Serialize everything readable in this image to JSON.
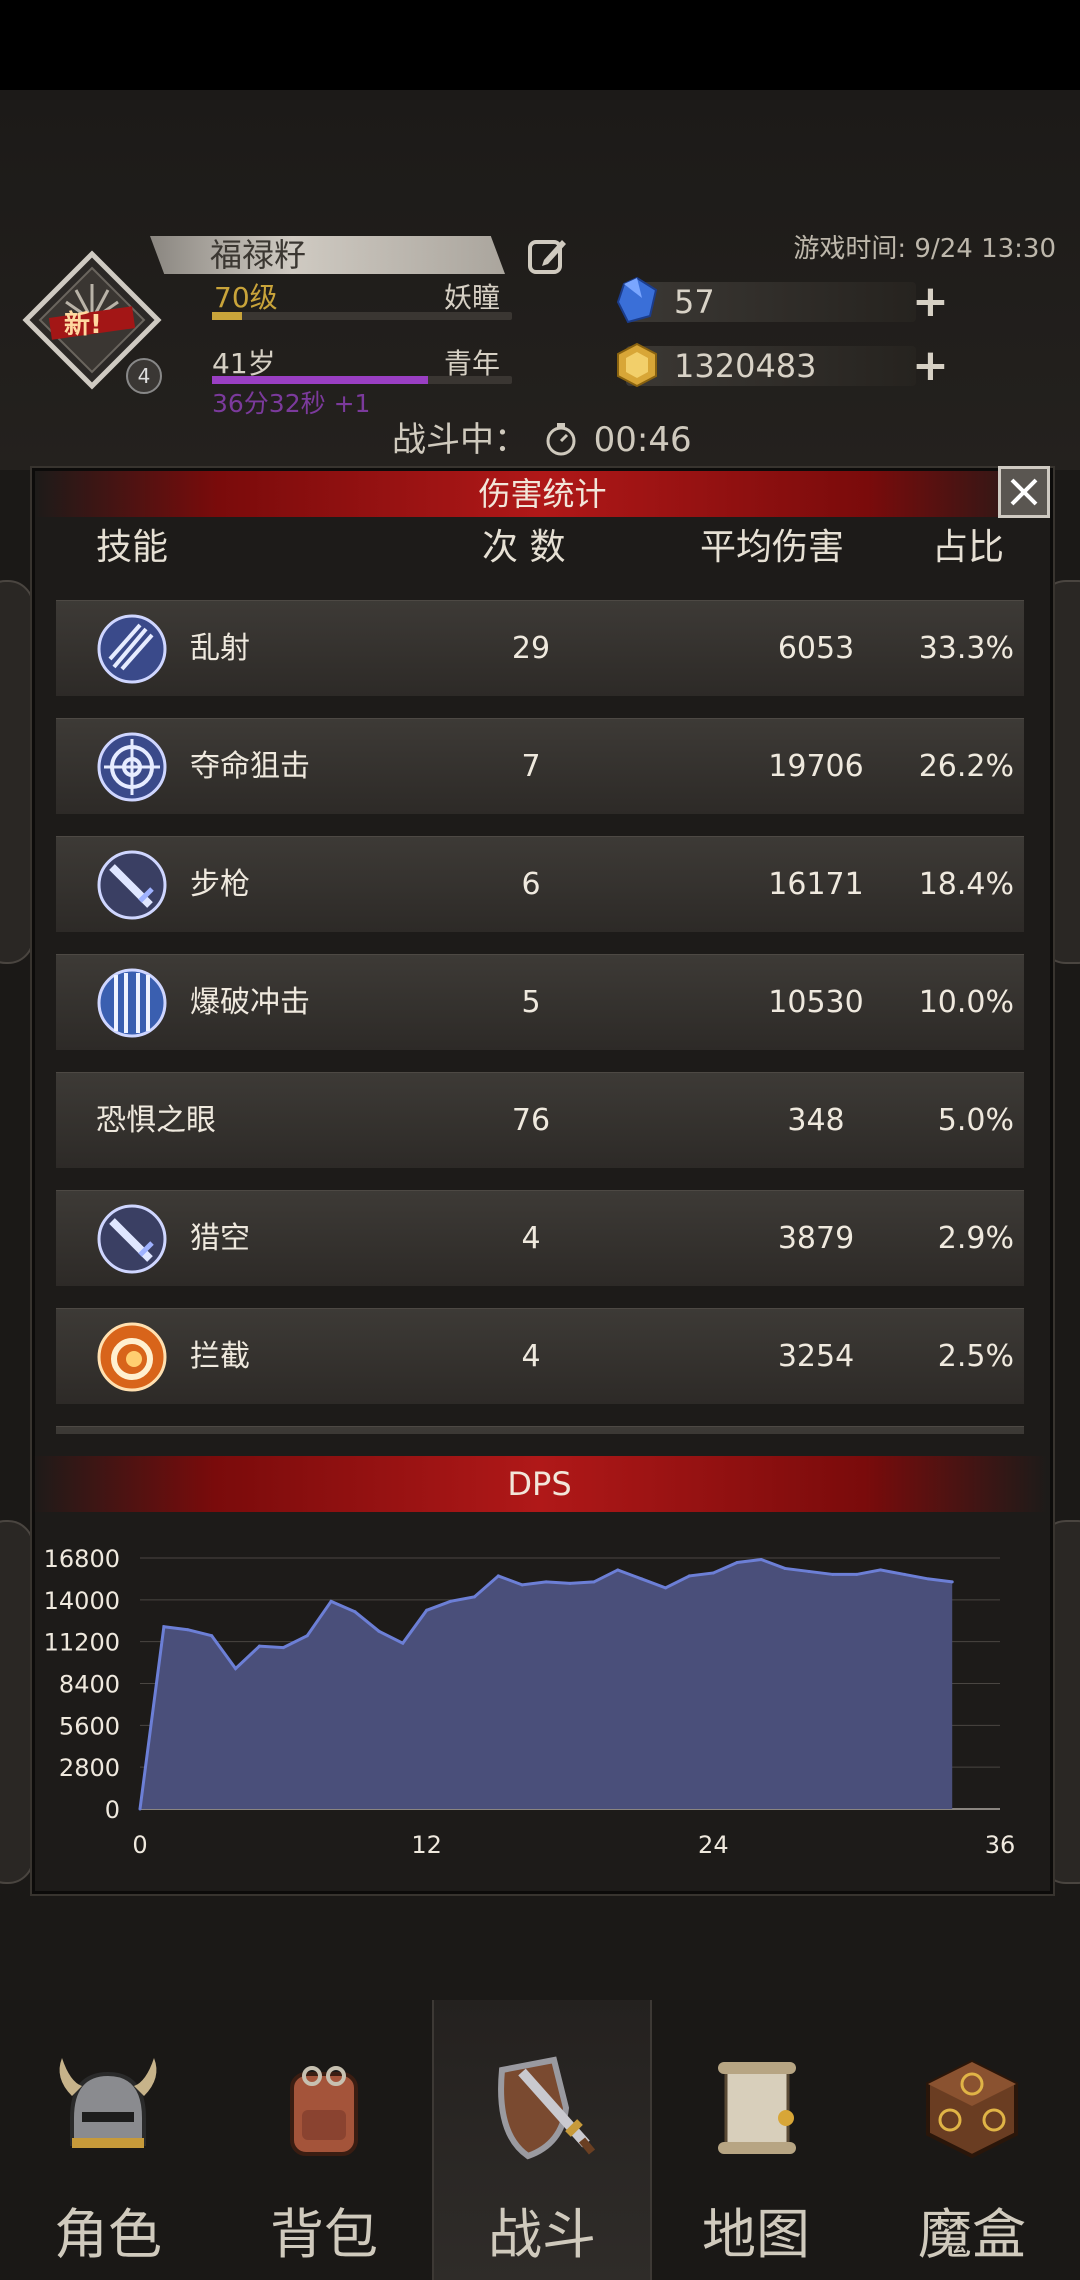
{
  "header": {
    "character_name": "福禄籽",
    "new_badge": "新!",
    "avatar_level": "4",
    "level_text": "70级",
    "race": "妖瞳",
    "age": "41岁",
    "age_stage": "青年",
    "timer_text": "36分32秒 +1",
    "game_time": "游戏时间: 9/24 13:30",
    "gems": "57",
    "gold": "1320483",
    "battle_label": "战斗中：",
    "battle_time": "00:46",
    "colors": {
      "level": "#c9a43a",
      "timer": "#9a3fc3",
      "gem": "#3a6fd8",
      "gold": "#d8a637"
    }
  },
  "panel": {
    "title": "伤害统计",
    "close_icon": "close-icon",
    "columns": {
      "skill": "技能",
      "count": "次 数",
      "avg": "平均伤害",
      "share": "占比"
    },
    "rows": [
      {
        "name": "乱射",
        "count": "29",
        "avg": "6053",
        "share": "33.3%",
        "icon": "arrow-volley-icon"
      },
      {
        "name": "夺命狙击",
        "count": "7",
        "avg": "19706",
        "share": "26.2%",
        "icon": "crosshair-icon"
      },
      {
        "name": "步枪",
        "count": "6",
        "avg": "16171",
        "share": "18.4%",
        "icon": "rifle-icon"
      },
      {
        "name": "爆破冲击",
        "count": "5",
        "avg": "10530",
        "share": "10.0%",
        "icon": "blast-icon"
      },
      {
        "name": "恐惧之眼",
        "count": "76",
        "avg": "348",
        "share": "5.0%",
        "icon": ""
      },
      {
        "name": "猎空",
        "count": "4",
        "avg": "3879",
        "share": "2.9%",
        "icon": "sword-icon"
      },
      {
        "name": "拦截",
        "count": "4",
        "avg": "3254",
        "share": "2.5%",
        "icon": "fire-ring-icon"
      }
    ]
  },
  "chart_data": {
    "type": "area",
    "title": "DPS",
    "xlabel": "",
    "ylabel": "",
    "x_ticks": [
      "0",
      "12",
      "24",
      "36"
    ],
    "y_ticks": [
      "16800",
      "14000",
      "11200",
      "8400",
      "5600",
      "2800",
      "0"
    ],
    "xlim": [
      0,
      36
    ],
    "ylim": [
      0,
      16800
    ],
    "grid": true,
    "x": [
      0,
      1,
      2,
      3,
      4,
      5,
      6,
      7,
      8,
      9,
      10,
      11,
      12,
      13,
      14,
      15,
      16,
      17,
      18,
      19,
      20,
      21,
      22,
      23,
      24,
      25,
      26,
      27,
      28,
      29,
      30,
      31,
      32,
      33,
      34
    ],
    "values": [
      0,
      12200,
      12000,
      11600,
      9400,
      10900,
      10800,
      11600,
      13900,
      13200,
      11900,
      11100,
      13300,
      13900,
      14200,
      15600,
      15000,
      15200,
      15100,
      15200,
      16000,
      15400,
      14800,
      15600,
      15800,
      16500,
      16700,
      16100,
      15900,
      15700,
      15700,
      16000,
      15700,
      15400,
      15200
    ],
    "colors": {
      "fill": "#4a4f7a",
      "line": "#6c7fd6"
    }
  },
  "nav": {
    "items": [
      {
        "label": "角色",
        "icon": "helmet-icon"
      },
      {
        "label": "背包",
        "icon": "backpack-icon"
      },
      {
        "label": "战斗",
        "icon": "shield-sword-icon"
      },
      {
        "label": "地图",
        "icon": "scroll-map-icon"
      },
      {
        "label": "魔盒",
        "icon": "magic-box-icon"
      }
    ],
    "active_index": 2
  }
}
